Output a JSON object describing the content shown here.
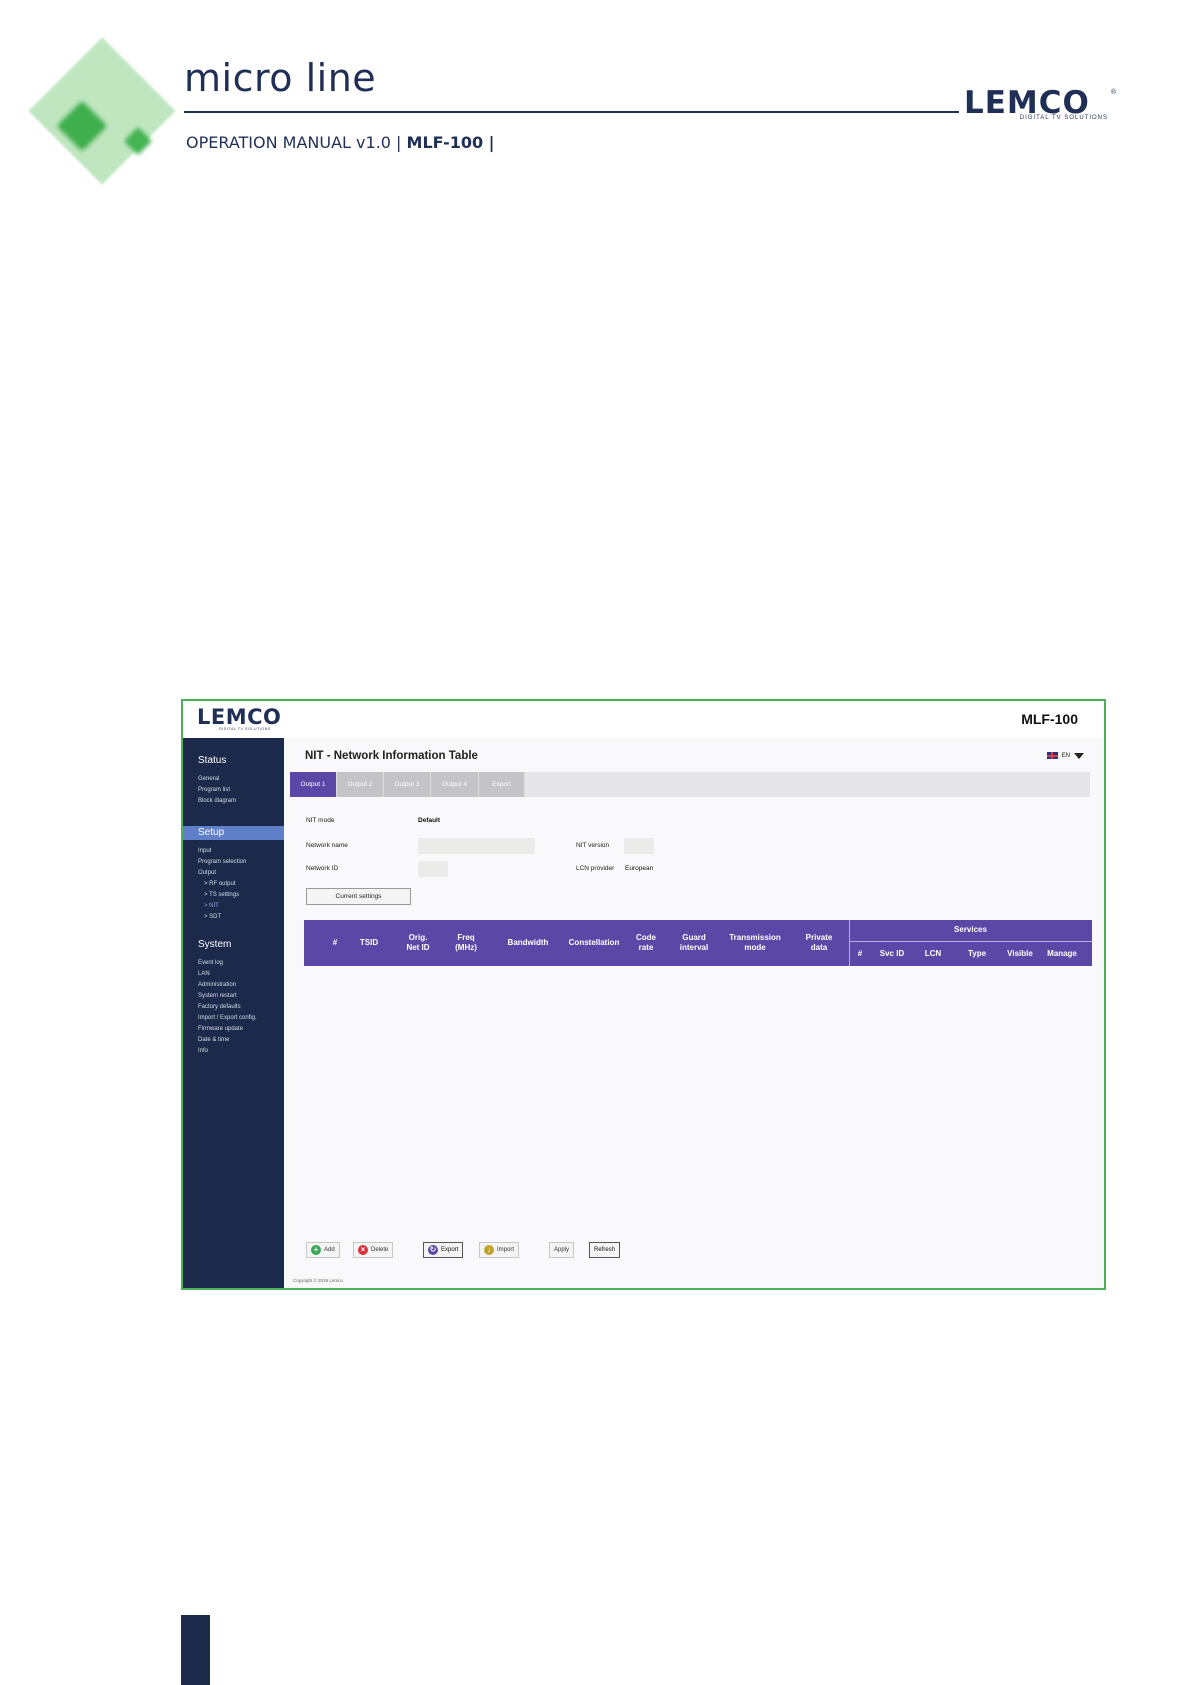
{
  "manual": {
    "title": "micro line",
    "subtitle_prefix": "OPERATION MANUAL v1.0 | ",
    "subtitle_model": "MLF-100 |",
    "brand": "LEMCO",
    "brand_tagline": "DIGITAL TV SOLUTIONS",
    "brand_registered": "®"
  },
  "app": {
    "logo": "LEMCO",
    "logo_tagline": "DIGITAL TV SOLUTIONS",
    "device": "MLF-100",
    "page_title": "NIT - Network Information Table",
    "language": "EN"
  },
  "sidebar": {
    "status": {
      "label": "Status",
      "items": [
        "General",
        "Program list",
        "Block diagram"
      ]
    },
    "setup": {
      "label": "Setup",
      "items": [
        "Input",
        "Program selection",
        "Output"
      ],
      "sub_items": [
        "> RF output",
        "> TS settings",
        "> NIT",
        "> SDT"
      ]
    },
    "system": {
      "label": "System",
      "items": [
        "Event log",
        "LAN",
        "Administration",
        "System restart",
        "Factory defaults",
        "Import / Export config.",
        "Firmware update",
        "Date & time",
        "Info"
      ]
    }
  },
  "tabs": [
    "Output 1",
    "Output 2",
    "Output 3",
    "Output 4",
    "Export"
  ],
  "form": {
    "nit_mode_label": "NIT mode",
    "nit_mode_value": "Default",
    "network_name_label": "Network name",
    "network_name_value": "",
    "network_id_label": "Network ID",
    "network_id_value": "",
    "nit_version_label": "NIT version",
    "nit_version_value": "",
    "lcn_provider_label": "LCN provider",
    "lcn_provider_value": "European",
    "current_settings_button": "Current settings"
  },
  "table": {
    "columns": [
      {
        "l1": "#",
        "l2": ""
      },
      {
        "l1": "TSID",
        "l2": ""
      },
      {
        "l1": "Orig.",
        "l2": "Net ID"
      },
      {
        "l1": "Freq",
        "l2": "(MHz)"
      },
      {
        "l1": "Bandwidth",
        "l2": ""
      },
      {
        "l1": "Constellation",
        "l2": ""
      },
      {
        "l1": "Code",
        "l2": "rate"
      },
      {
        "l1": "Guard",
        "l2": "interval"
      },
      {
        "l1": "Transmission",
        "l2": "mode"
      },
      {
        "l1": "Private",
        "l2": "data"
      }
    ],
    "services_header": "Services",
    "services_columns": [
      "#",
      "Svc ID",
      "LCN",
      "Type",
      "Visible",
      "Manage"
    ],
    "rows": []
  },
  "actions": {
    "add": "Add",
    "delete": "Delete",
    "export": "Export",
    "import": "Import",
    "apply": "Apply",
    "refresh": "Refresh"
  },
  "copyright": "Copyright © 2019 Lemco",
  "colors": {
    "navy": "#1b2a4a",
    "purple": "#5b48a6",
    "setup_active": "#5f7fc8",
    "frame_green": "#4db257"
  }
}
